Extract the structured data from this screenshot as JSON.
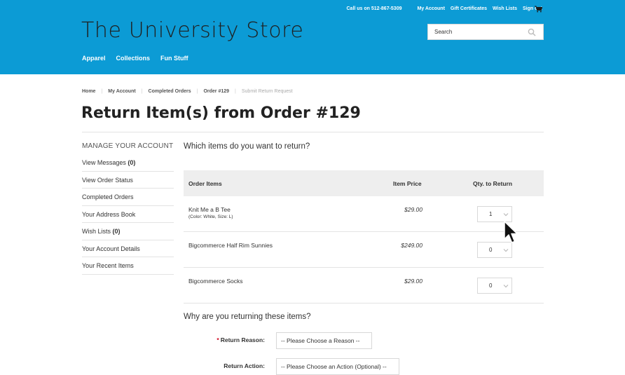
{
  "header": {
    "phone_text": "Call us on 512-867-5309",
    "top_links": [
      "My Account",
      "Gift Certificates",
      "Wish Lists",
      "Sign out"
    ],
    "logo": "The University Store",
    "search_placeholder": "Search",
    "main_nav": [
      "Apparel",
      "Collections",
      "Fun Stuff"
    ],
    "cart_icon": "cart-icon",
    "search_icon": "search-icon"
  },
  "breadcrumb": [
    "Home",
    "My Account",
    "Completed Orders",
    "Order #129"
  ],
  "breadcrumb_current": "Submit Return Request",
  "page_title": "Return Item(s) from Order #129",
  "sidebar": {
    "heading": "MANAGE YOUR ACCOUNT",
    "items": [
      {
        "label": "View Messages",
        "count": "(0)"
      },
      {
        "label": "View Order Status",
        "count": ""
      },
      {
        "label": "Completed Orders",
        "count": ""
      },
      {
        "label": "Your Address Book",
        "count": ""
      },
      {
        "label": "Wish Lists",
        "count": "(0)"
      },
      {
        "label": "Your Account Details",
        "count": ""
      },
      {
        "label": "Your Recent Items",
        "count": ""
      }
    ]
  },
  "items_question": "Which items do you want to return?",
  "table": {
    "headers": [
      "Order Items",
      "Item Price",
      "Qty. to Return"
    ],
    "rows": [
      {
        "name": "Knit Me a B Tee",
        "sub": "(Color: White, Size: L)",
        "price": "$29.00",
        "qty": "1"
      },
      {
        "name": "Bigcommerce Half Rim Sunnies",
        "sub": "",
        "price": "$249.00",
        "qty": "0"
      },
      {
        "name": "Bigcommerce Socks",
        "sub": "",
        "price": "$29.00",
        "qty": "0"
      }
    ]
  },
  "why_question": "Why are you returning these items?",
  "form": {
    "reason_label": "Return Reason:",
    "reason_required_mark": "*",
    "reason_value": "-- Please Choose a Reason --",
    "action_label": "Return Action:",
    "action_value": "-- Please Choose an Action (Optional) --"
  },
  "colors": {
    "header_bg": "#0c9bd5",
    "required": "#d0021b"
  }
}
